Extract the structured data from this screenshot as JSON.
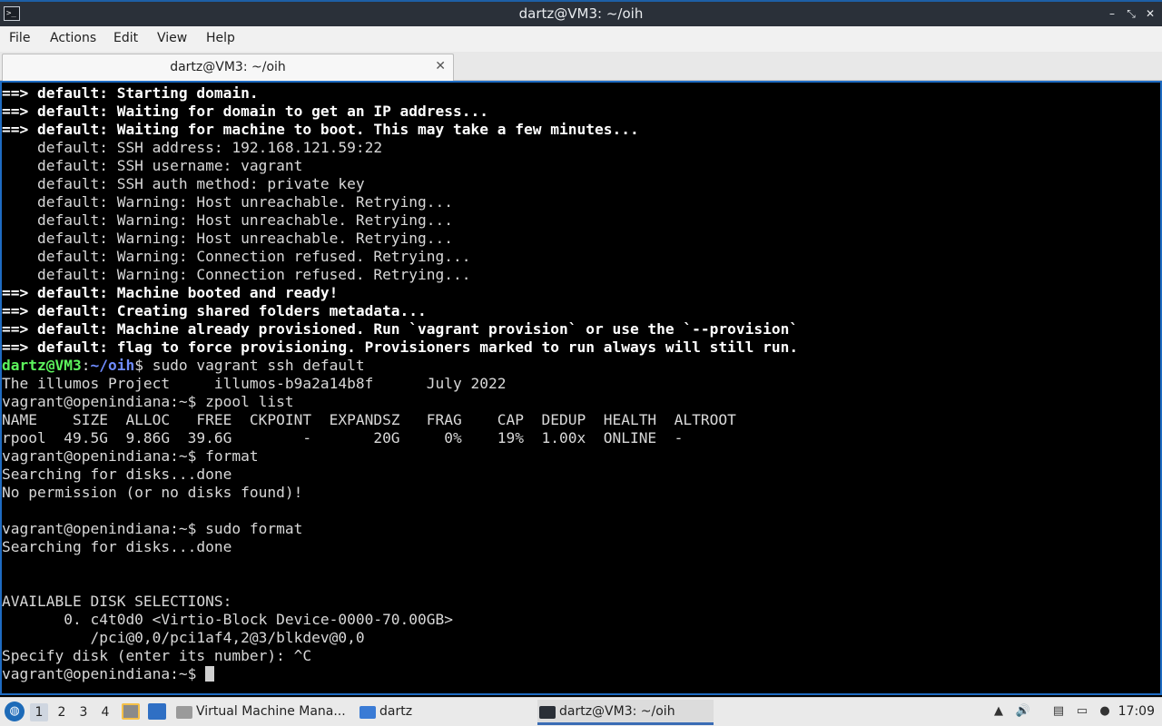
{
  "window": {
    "title": "dartz@VM3: ~/oih",
    "controls": [
      "–",
      "⤡",
      "✕"
    ]
  },
  "menu": [
    "File",
    "Actions",
    "Edit",
    "View",
    "Help"
  ],
  "tab": {
    "label": "dartz@VM3: ~/oih",
    "close": "✕"
  },
  "terminal": {
    "lines": [
      {
        "t": "==> default: Starting domain.",
        "b": true
      },
      {
        "t": "==> default: Waiting for domain to get an IP address...",
        "b": true
      },
      {
        "t": "==> default: Waiting for machine to boot. This may take a few minutes...",
        "b": true
      },
      {
        "t": "    default: SSH address: 192.168.121.59:22",
        "b": false
      },
      {
        "t": "    default: SSH username: vagrant",
        "b": false
      },
      {
        "t": "    default: SSH auth method: private key",
        "b": false
      },
      {
        "t": "    default: Warning: Host unreachable. Retrying...",
        "b": false
      },
      {
        "t": "    default: Warning: Host unreachable. Retrying...",
        "b": false
      },
      {
        "t": "    default: Warning: Host unreachable. Retrying...",
        "b": false
      },
      {
        "t": "    default: Warning: Connection refused. Retrying...",
        "b": false
      },
      {
        "t": "    default: Warning: Connection refused. Retrying...",
        "b": false
      },
      {
        "t": "==> default: Machine booted and ready!",
        "b": true
      },
      {
        "t": "==> default: Creating shared folders metadata...",
        "b": true
      },
      {
        "t": "==> default: Machine already provisioned. Run `vagrant provision` or use the `--provision`",
        "b": true
      },
      {
        "t": "==> default: flag to force provisioning. Provisioners marked to run always will still run.",
        "b": true
      },
      {
        "prompt_user": "dartz@VM3",
        "prompt_sep": ":",
        "prompt_path": "~/oih",
        "t": "$ sudo vagrant ssh default"
      },
      {
        "t": "The illumos Project     illumos-b9a2a14b8f      July 2022",
        "b": false
      },
      {
        "t": "vagrant@openindiana:~$ zpool list",
        "b": false
      },
      {
        "t": "NAME    SIZE  ALLOC   FREE  CKPOINT  EXPANDSZ   FRAG    CAP  DEDUP  HEALTH  ALTROOT",
        "b": false
      },
      {
        "t": "rpool  49.5G  9.86G  39.6G        -       20G     0%    19%  1.00x  ONLINE  -",
        "b": false
      },
      {
        "t": "vagrant@openindiana:~$ format",
        "b": false
      },
      {
        "t": "Searching for disks...done",
        "b": false
      },
      {
        "t": "No permission (or no disks found)!",
        "b": false
      },
      {
        "t": "",
        "b": false
      },
      {
        "t": "vagrant@openindiana:~$ sudo format",
        "b": false
      },
      {
        "t": "Searching for disks...done",
        "b": false
      },
      {
        "t": "",
        "b": false
      },
      {
        "t": "",
        "b": false
      },
      {
        "t": "AVAILABLE DISK SELECTIONS:",
        "b": false
      },
      {
        "t": "       0. c4t0d0 <Virtio-Block Device-0000-70.00GB>",
        "b": false
      },
      {
        "t": "          /pci@0,0/pci1af4,2@3/blkdev@0,0",
        "b": false
      },
      {
        "t": "Specify disk (enter its number): ^C",
        "b": false
      },
      {
        "t": "vagrant@openindiana:~$ ",
        "b": false,
        "cursor": true
      }
    ]
  },
  "taskbar": {
    "workspaces": [
      "1",
      "2",
      "3",
      "4"
    ],
    "tasks": [
      {
        "label": "Virtual Machine Mana...",
        "icon": "vm-manager-icon"
      },
      {
        "label": "dartz",
        "icon": "folder-icon"
      },
      {
        "label": "dartz@VM3: ~/oih",
        "icon": "terminal-icon"
      }
    ],
    "clock": "17:09"
  }
}
